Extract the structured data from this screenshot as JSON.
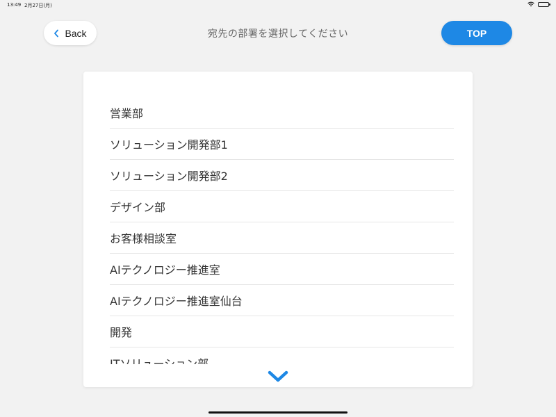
{
  "status_bar": {
    "time": "13:49",
    "date": "2月27日(月)",
    "icons": [
      "wifi-icon",
      "battery-icon"
    ]
  },
  "header": {
    "back_label": "Back",
    "title": "宛先の部署を選択してください",
    "top_label": "TOP"
  },
  "departments": [
    {
      "label": "営業部"
    },
    {
      "label": "ソリューション開発部1"
    },
    {
      "label": "ソリューション開発部2"
    },
    {
      "label": "デザイン部"
    },
    {
      "label": "お客様相談室"
    },
    {
      "label": "AIテクノロジー推進室"
    },
    {
      "label": "AIテクノロジー推進室仙台"
    },
    {
      "label": "開発"
    },
    {
      "label": "ITソリューション部"
    }
  ],
  "colors": {
    "accent": "#1e88e5",
    "background": "#f2f2f2",
    "card": "#ffffff",
    "divider": "#e6e6e6"
  }
}
